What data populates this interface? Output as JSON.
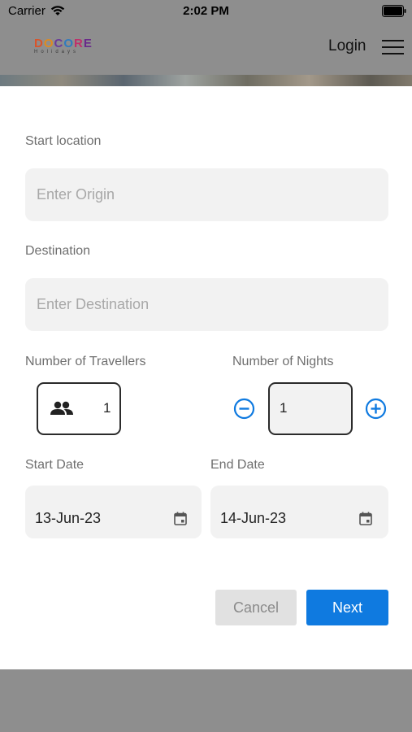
{
  "status_bar": {
    "carrier": "Carrier",
    "time": "2:02 PM"
  },
  "header": {
    "logo_text": "DOCORE",
    "logo_subtext": "Holidays",
    "login_label": "Login"
  },
  "form": {
    "start_location": {
      "label": "Start location",
      "placeholder": "Enter Origin"
    },
    "destination": {
      "label": "Destination",
      "placeholder": "Enter Destination"
    },
    "travellers": {
      "label": "Number of Travellers",
      "value": "1"
    },
    "nights": {
      "label": "Number of Nights",
      "value": "1"
    },
    "start_date": {
      "label": "Start Date",
      "value": "13-Jun-23"
    },
    "end_date": {
      "label": "End Date",
      "value": "14-Jun-23"
    }
  },
  "actions": {
    "cancel_label": "Cancel",
    "next_label": "Next"
  },
  "colors": {
    "accent": "#0f7ae0",
    "overlay": "#8e8e8e",
    "field_bg": "#f2f2f2"
  }
}
